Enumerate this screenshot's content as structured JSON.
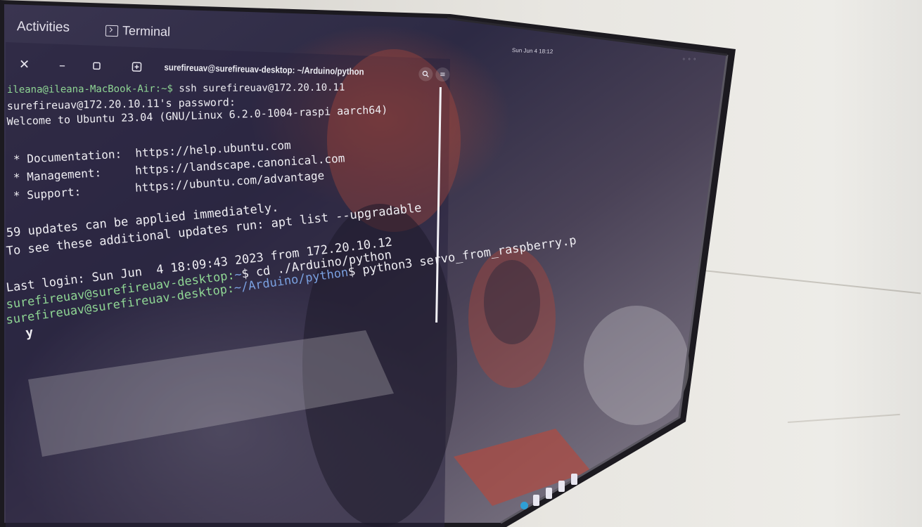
{
  "topbar": {
    "activities": "Activities",
    "app_name": "Terminal",
    "clock": "Sun Jun 4 18:12"
  },
  "window": {
    "title": "surefireuav@surefireuav-desktop: ~/Arduino/python",
    "close_icon": "close-icon",
    "minimize_icon": "minimize-icon",
    "maximize_icon": "maximize-icon",
    "new_tab_icon": "new-tab-icon",
    "search_icon": "search-icon",
    "menu_icon": "hamburger-menu-icon"
  },
  "terminal": {
    "line1_prompt": "ileana@ileana-MacBook-Air:~$ ",
    "line1_cmd": "ssh surefireuav@172.20.10.11",
    "line2": "surefireuav@172.20.10.11's password:",
    "line3": "Welcome to Ubuntu 23.04 (GNU/Linux 6.2.0-1004-raspi aarch64)",
    "doc_label": " * Documentation:  ",
    "doc_url": "https://help.ubuntu.com",
    "mgmt_label": " * Management:     ",
    "mgmt_url": "https://landscape.canonical.com",
    "support_label": " * Support:        ",
    "support_url": "https://ubuntu.com/advantage",
    "updates_1": "59 updates can be applied immediately.",
    "updates_2": "To see these additional updates run: apt list --upgradable",
    "last_login": "Last login: Sun Jun  4 18:09:43 2023 from 172.20.10.12",
    "p1_user": "surefireuav@surefireuav-desktop:",
    "p1_path": "~",
    "p1_cmd": "$ cd ./Arduino/python",
    "p2_user": "surefireuav@surefireuav-desktop:",
    "p2_path": "~/Arduino/python",
    "p2_cmd": "$ python3 servo_from_raspberry.p",
    "input_line": "y"
  },
  "colors": {
    "prompt_user": "#8fd694",
    "prompt_path": "#7aa0e0",
    "text": "#efeef3"
  }
}
